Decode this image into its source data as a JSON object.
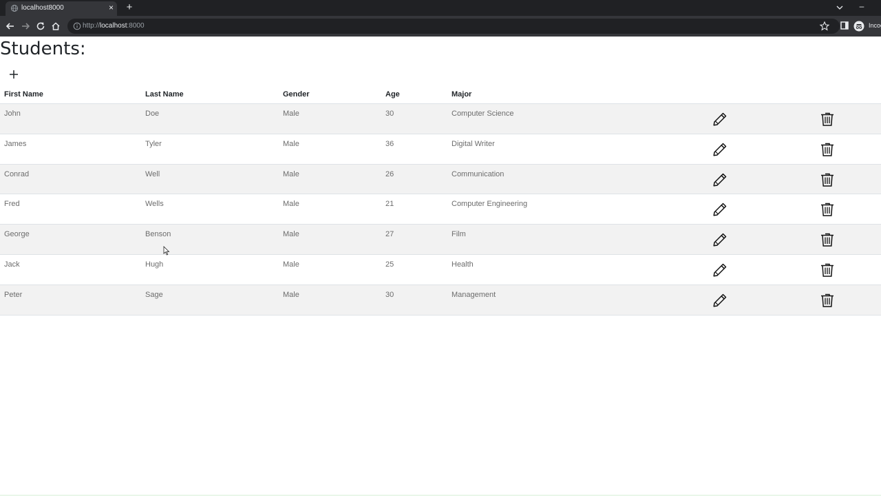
{
  "browser": {
    "tab_title": "localhost8000",
    "tab_close": "×",
    "new_tab": "+",
    "minimize": "–",
    "url_prefix": "http://",
    "url_host": "localhost",
    "url_port": ":8000",
    "profile_label": "Incog"
  },
  "page": {
    "title": "Students:"
  },
  "table": {
    "headers": [
      "First Name",
      "Last Name",
      "Gender",
      "Age",
      "Major"
    ],
    "rows": [
      [
        "John",
        "Doe",
        "Male",
        "30",
        "Computer Science"
      ],
      [
        "James",
        "Tyler",
        "Male",
        "36",
        "Digital Writer"
      ],
      [
        "Conrad",
        "Well",
        "Male",
        "26",
        "Communication"
      ],
      [
        "Fred",
        "Wells",
        "Male",
        "21",
        "Computer Engineering"
      ],
      [
        "George",
        "Benson",
        "Male",
        "27",
        "Film"
      ],
      [
        "Jack",
        "Hugh",
        "Male",
        "25",
        "Health"
      ],
      [
        "Peter",
        "Sage",
        "Male",
        "30",
        "Management"
      ]
    ]
  },
  "icons": {
    "add": "plus-icon",
    "edit": "pencil-icon",
    "delete": "trash-icon"
  },
  "colors": {
    "chrome_dark": "#202124",
    "chrome_toolbar": "#35363a",
    "row_stripe": "#f2f2f2",
    "text_muted": "#6c6c6c"
  }
}
